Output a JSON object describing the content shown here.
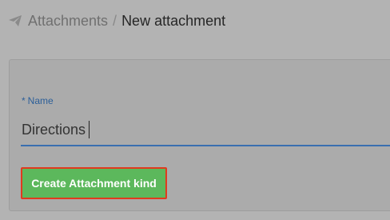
{
  "breadcrumb": {
    "icon": "paper-plane-icon",
    "parent": "Attachments",
    "separator": "/",
    "current": "New attachment"
  },
  "form": {
    "name_field": {
      "required_marker": "*",
      "label": "Name",
      "value": "Directions"
    },
    "submit_label": "Create Attachment kind"
  },
  "colors": {
    "label": "#2c5f99",
    "underline": "#3a6fb0",
    "button": "#5cb85c",
    "button_highlight": "#e03a1e"
  }
}
